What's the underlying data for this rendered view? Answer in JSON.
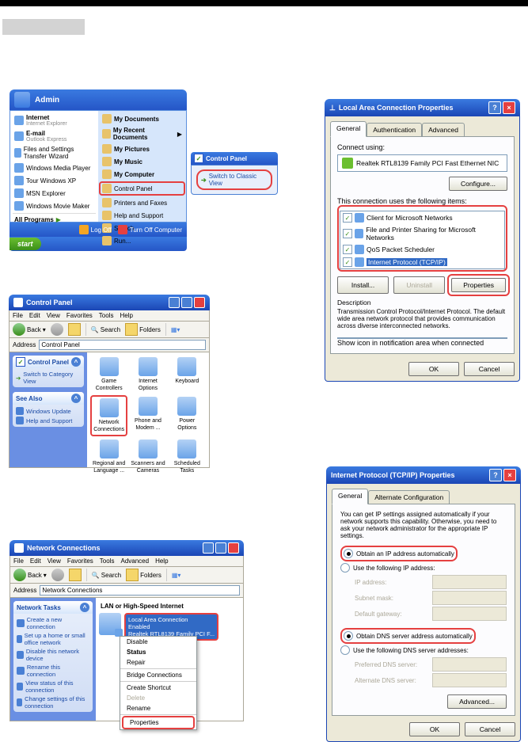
{
  "startmenu": {
    "user": "Admin",
    "left": {
      "internet": {
        "title": "Internet",
        "sub": "Internet Explorer"
      },
      "email": {
        "title": "E-mail",
        "sub": "Outlook Express"
      },
      "fst": "Files and Settings Transfer Wizard",
      "wmp": "Windows Media Player",
      "tour": "Tour Windows XP",
      "msn": "MSN Explorer",
      "wmm": "Windows Movie Maker",
      "all": "All Programs"
    },
    "right": {
      "docs": "My Documents",
      "recent": "My Recent Documents",
      "pics": "My Pictures",
      "music": "My Music",
      "computer": "My Computer",
      "cpanel": "Control Panel",
      "printers": "Printers and Faxes",
      "help": "Help and Support",
      "search": "Search",
      "run": "Run..."
    },
    "footer": {
      "logoff": "Log Off",
      "turnoff": "Turn Off Computer"
    },
    "taskbar_start": "start"
  },
  "classic": {
    "title": "Control Panel",
    "link": "Switch to Classic View"
  },
  "cpwin": {
    "title": "Control Panel",
    "menu": [
      "File",
      "Edit",
      "View",
      "Favorites",
      "Tools",
      "Help"
    ],
    "toolbar": {
      "back": "Back",
      "search": "Search",
      "folders": "Folders"
    },
    "addr_label": "Address",
    "addr_value": "Control Panel",
    "side_cp": {
      "title": "Control Panel",
      "link": "Switch to Category View"
    },
    "side_see": {
      "title": "See Also",
      "item1": "Windows Update",
      "item2": "Help and Support"
    },
    "icons": {
      "game": "Game Controllers",
      "inet": "Internet Options",
      "kbd": "Keyboard",
      "net": "Network Connections",
      "phone": "Phone and Modem ...",
      "power": "Power Options",
      "regional": "Regional and Language ...",
      "scan": "Scanners and Cameras",
      "sched": "Scheduled Tasks"
    }
  },
  "lanprop": {
    "title": "Local Area Connection Properties",
    "tabs": {
      "general": "General",
      "auth": "Authentication",
      "adv": "Advanced"
    },
    "connect_label": "Connect using:",
    "nic": "Realtek RTL8139 Family PCI Fast Ethernet NIC",
    "configure": "Configure...",
    "uses_label": "This connection uses the following items:",
    "items": {
      "cms": "Client for Microsoft Networks",
      "fps": "File and Printer Sharing for Microsoft Networks",
      "qos": "QoS Packet Scheduler",
      "tcp": "Internet Protocol (TCP/IP)"
    },
    "install": "Install...",
    "uninstall": "Uninstall",
    "properties": "Properties",
    "desc_label": "Description",
    "desc_text": "Transmission Control Protocol/Internet Protocol. The default wide area network protocol that provides communication across diverse interconnected networks.",
    "showicon": "Show icon in notification area when connected",
    "ok": "OK",
    "cancel": "Cancel"
  },
  "ncwin": {
    "title": "Network Connections",
    "menu": [
      "File",
      "Edit",
      "View",
      "Favorites",
      "Tools",
      "Advanced",
      "Help"
    ],
    "toolbar": {
      "back": "Back",
      "search": "Search",
      "folders": "Folders"
    },
    "addr_label": "Address",
    "addr_value": "Network Connections",
    "side_title": "Network Tasks",
    "side_items": {
      "create": "Create a new connection",
      "setup": "Set up a home or small office network",
      "disable": "Disable this network device",
      "rename": "Rename this connection",
      "status": "View status of this connection",
      "change": "Change settings of this connection"
    },
    "section": "LAN or High-Speed Internet",
    "conn": {
      "name": "Local Area Connection",
      "status": "Enabled",
      "device": "Realtek RTL8139 Family PCI F..."
    },
    "ctx": {
      "disable": "Disable",
      "status": "Status",
      "repair": "Repair",
      "bridge": "Bridge Connections",
      "shortcut": "Create Shortcut",
      "delete": "Delete",
      "rename": "Rename",
      "properties": "Properties"
    }
  },
  "tcpip": {
    "title": "Internet Protocol (TCP/IP) Properties",
    "tabs": {
      "general": "General",
      "alt": "Alternate Configuration"
    },
    "intro": "You can get IP settings assigned automatically if your network supports this capability. Otherwise, you need to ask your network administrator for the appropriate IP settings.",
    "auto_ip": "Obtain an IP address automatically",
    "use_ip": "Use the following IP address:",
    "ip_addr": "IP address:",
    "subnet": "Subnet mask:",
    "gateway": "Default gateway:",
    "auto_dns": "Obtain DNS server address automatically",
    "use_dns": "Use the following DNS server addresses:",
    "pref_dns": "Preferred DNS server:",
    "alt_dns": "Alternate DNS server:",
    "advanced": "Advanced...",
    "ok": "OK",
    "cancel": "Cancel"
  }
}
